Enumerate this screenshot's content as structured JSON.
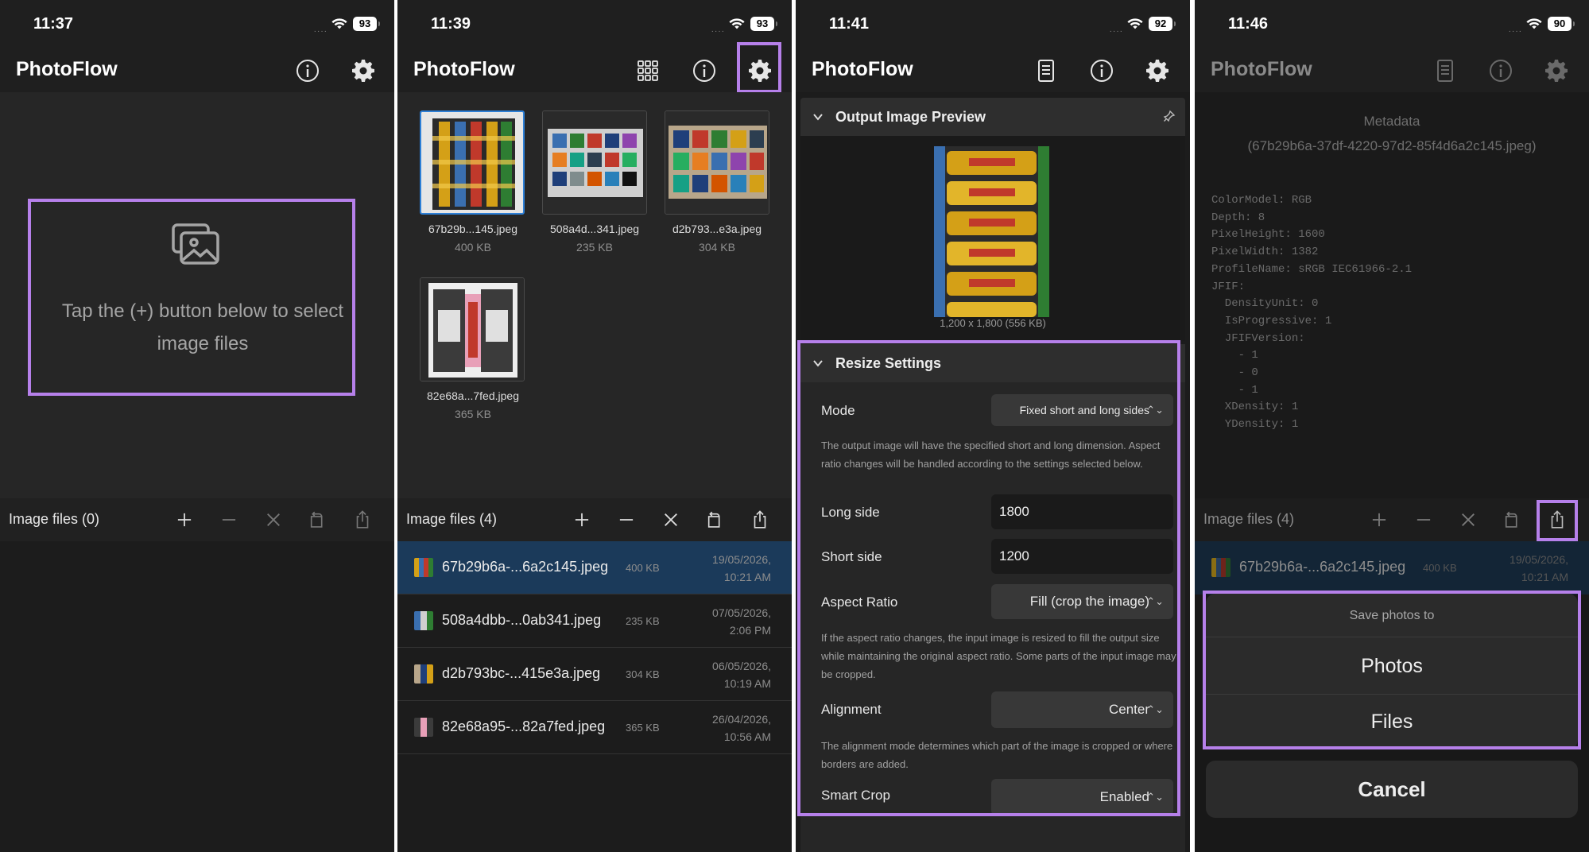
{
  "colors": {
    "accent": "#b680ea",
    "selection_blue": "#2d7fd6",
    "background": "#1f1f1f"
  },
  "s1": {
    "time": "11:37",
    "battery": "93",
    "app_title": "PhotoFlow",
    "empty_hint": "Tap the (+) button below to select image files",
    "toolbar_title": "Image files (0)"
  },
  "s2": {
    "time": "11:39",
    "battery": "93",
    "app_title": "PhotoFlow",
    "thumbs": [
      {
        "name": "67b29b...145.jpeg",
        "size": "400 KB"
      },
      {
        "name": "508a4d...341.jpeg",
        "size": "235 KB"
      },
      {
        "name": "d2b793...e3a.jpeg",
        "size": "304 KB"
      },
      {
        "name": "82e68a...7fed.jpeg",
        "size": "365 KB"
      }
    ],
    "toolbar_title": "Image files (4)",
    "rows": [
      {
        "name": "67b29b6a-...6a2c145.jpeg",
        "size": "400 KB",
        "date": "19/05/2026,",
        "time": "10:21 AM"
      },
      {
        "name": "508a4dbb-...0ab341.jpeg",
        "size": "235 KB",
        "date": "07/05/2026,",
        "time": "2:06 PM"
      },
      {
        "name": "d2b793bc-...415e3a.jpeg",
        "size": "304 KB",
        "date": "06/05/2026,",
        "time": "10:19 AM"
      },
      {
        "name": "82e68a95-...82a7fed.jpeg",
        "size": "365 KB",
        "date": "26/04/2026,",
        "time": "10:56 AM"
      }
    ]
  },
  "s3": {
    "time": "11:41",
    "battery": "92",
    "app_title": "PhotoFlow",
    "preview_title": "Output Image Preview",
    "preview_caption": "1,200 x 1,800 (556 KB)",
    "resize_title": "Resize Settings",
    "mode_label": "Mode",
    "mode_value": "Fixed short and long sides",
    "mode_desc": "The output image will have the specified short and long dimension. Aspect ratio changes will be handled according to the settings selected below.",
    "long_label": "Long side",
    "long_value": "1800",
    "short_label": "Short side",
    "short_value": "1200",
    "aspect_label": "Aspect Ratio",
    "aspect_value": "Fill (crop the image)",
    "aspect_desc": "If the aspect ratio changes, the input image is resized to fill the output size while maintaining the original aspect ratio. Some parts of the input image may be cropped.",
    "align_label": "Alignment",
    "align_value": "Center",
    "align_desc": "The alignment mode determines which part of the image is cropped or where borders are added.",
    "smart_label": "Smart Crop",
    "smart_value": "Enabled"
  },
  "s4": {
    "time": "11:46",
    "battery": "90",
    "app_title": "PhotoFlow",
    "meta_title": "Metadata",
    "meta_id": "(67b29b6a-37df-4220-97d2-85f4d6a2c145.jpeg)",
    "meta_lines": [
      "ColorModel: RGB",
      "Depth: 8",
      "PixelHeight: 1600",
      "PixelWidth: 1382",
      "ProfileName: sRGB IEC61966-2.1",
      "JFIF:",
      "  DensityUnit: 0",
      "  IsProgressive: 1",
      "  JFIFVersion:",
      "    - 1",
      "    - 0",
      "    - 1",
      "  XDensity: 1",
      "  YDensity: 1"
    ],
    "toolbar_title": "Image files (4)",
    "row": {
      "name": "67b29b6a-...6a2c145.jpeg",
      "size": "400 KB",
      "date": "19/05/2026,",
      "time": "10:21 AM"
    },
    "sheet_title": "Save photos to",
    "opt_photos": "Photos",
    "opt_files": "Files",
    "cancel": "Cancel"
  }
}
